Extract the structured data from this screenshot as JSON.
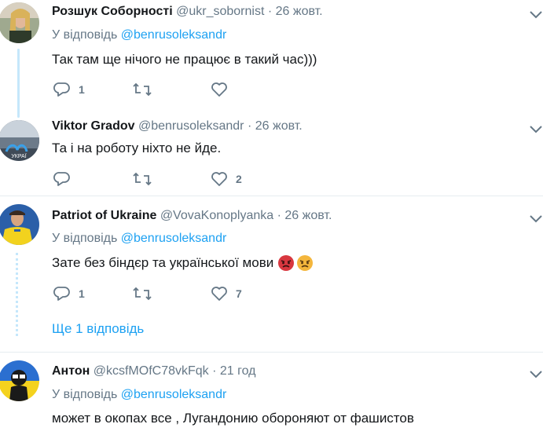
{
  "tweets": [
    {
      "name": "Розшук Соборності",
      "handle": "@ukr_sobornist",
      "dot": "·",
      "time": "26 жовт.",
      "reply_prefix": "У відповідь",
      "reply_to": "@benrusoleksandr",
      "text": "Так там ще нічого не працює в такий час)))",
      "replies": "1",
      "likes": ""
    },
    {
      "name": "Viktor Gradov",
      "handle": "@benrusoleksandr",
      "dot": "·",
      "time": "26 жовт.",
      "text": "Та і на роботу ніхто не йде.",
      "replies": "",
      "likes": "2"
    },
    {
      "name": "Patriot of Ukraine",
      "handle": "@VovaKonoplyanka",
      "dot": "·",
      "time": "26 жовт.",
      "reply_prefix": "У відповідь",
      "reply_to": "@benrusoleksandr",
      "text": "Зате без біндєр та української мови",
      "replies": "1",
      "likes": "7",
      "show_replies": "Ще 1 відповідь"
    },
    {
      "name": "Антон",
      "handle": "@kcsfMOfC78vkFqk",
      "dot": "·",
      "time": "21 год",
      "reply_prefix": "У відповідь",
      "reply_to": "@benrusoleksandr",
      "text": "может в окопах все , Лугандонию обороняют от фашистов"
    }
  ],
  "colors": {
    "accent": "#1da1f2",
    "muted": "#657786",
    "thread": "#c5e7fb"
  }
}
